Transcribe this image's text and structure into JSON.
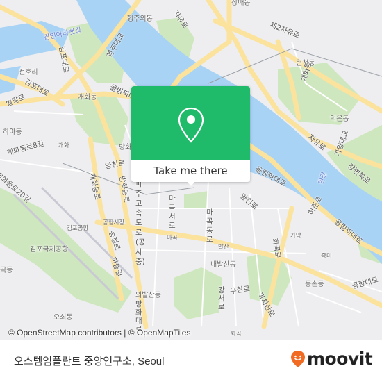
{
  "map": {
    "colors": {
      "land": "#eeeef0",
      "water": "#a9d3f5",
      "park": "#cfe7bf",
      "major_road": "#fbe39d",
      "minor_road": "#ffffff",
      "label": "#6b6b6b",
      "water_label": "#6f7fd0"
    },
    "labels": [
      {
        "text": "행주외동",
        "kind": "area"
      },
      {
        "text": "자유로",
        "kind": "road"
      },
      {
        "text": "장매동",
        "kind": "area"
      },
      {
        "text": "제2자유로",
        "kind": "road"
      },
      {
        "text": "경인아라뱃길",
        "kind": "water"
      },
      {
        "text": "김포대로",
        "kind": "road"
      },
      {
        "text": "개화동",
        "kind": "area"
      },
      {
        "text": "행주대교",
        "kind": "road"
      },
      {
        "text": "전호리",
        "kind": "area"
      },
      {
        "text": "김포대로",
        "kind": "road"
      },
      {
        "text": "올림픽대로",
        "kind": "road"
      },
      {
        "text": "현천동",
        "kind": "area"
      },
      {
        "text": "벌말로",
        "kind": "road"
      },
      {
        "text": "개화동",
        "kind": "area"
      },
      {
        "text": "하야동",
        "kind": "area"
      },
      {
        "text": "개화동로8길",
        "kind": "road"
      },
      {
        "text": "개화",
        "kind": "station"
      },
      {
        "text": "방화",
        "kind": "station"
      },
      {
        "text": "덕은동",
        "kind": "area"
      },
      {
        "text": "자유로",
        "kind": "road"
      },
      {
        "text": "가양대교",
        "kind": "road"
      },
      {
        "text": "강변북로",
        "kind": "road"
      },
      {
        "text": "양천로",
        "kind": "road"
      },
      {
        "text": "개화동로20길",
        "kind": "road"
      },
      {
        "text": "개화동로",
        "kind": "road"
      },
      {
        "text": "방화동로",
        "kind": "road"
      },
      {
        "text": "파주고속도로 (공사중)",
        "kind": "road"
      },
      {
        "text": "올림픽대로",
        "kind": "road"
      },
      {
        "text": "한강",
        "kind": "water"
      },
      {
        "text": "양천로",
        "kind": "road"
      },
      {
        "text": "마곡서로",
        "kind": "road"
      },
      {
        "text": "마곡동로",
        "kind": "road"
      },
      {
        "text": "허준로",
        "kind": "road"
      },
      {
        "text": "올림픽대로",
        "kind": "road"
      },
      {
        "text": "김포공항",
        "kind": "station"
      },
      {
        "text": "공항시장",
        "kind": "station"
      },
      {
        "text": "송정로",
        "kind": "road"
      },
      {
        "text": "가양",
        "kind": "station"
      },
      {
        "text": "김포국제공항",
        "kind": "area"
      },
      {
        "text": "마곡",
        "kind": "station"
      },
      {
        "text": "발산",
        "kind": "station"
      },
      {
        "text": "화곡로",
        "kind": "road"
      },
      {
        "text": "증미",
        "kind": "station"
      },
      {
        "text": "하늘길",
        "kind": "road"
      },
      {
        "text": "내발산동",
        "kind": "area"
      },
      {
        "text": "곡동",
        "kind": "area"
      },
      {
        "text": "등촌동",
        "kind": "area"
      },
      {
        "text": "외발산동",
        "kind": "area"
      },
      {
        "text": "강서로",
        "kind": "road"
      },
      {
        "text": "우현로",
        "kind": "road"
      },
      {
        "text": "까치산로",
        "kind": "road"
      },
      {
        "text": "공항대로",
        "kind": "road"
      },
      {
        "text": "방화대로",
        "kind": "road"
      },
      {
        "text": "오쇠동",
        "kind": "area"
      },
      {
        "text": "화곡",
        "kind": "station"
      }
    ]
  },
  "popup": {
    "icon": "map-pin-icon",
    "cta_label": "Take me there",
    "color": "#1fba6a"
  },
  "attribution": "© OpenStreetMap contributors | © OpenMapTiles",
  "footer": {
    "place_name": "오스템임플란트 중앙연구소, Seoul",
    "brand": "moovit",
    "brand_color": "#f26b22"
  }
}
